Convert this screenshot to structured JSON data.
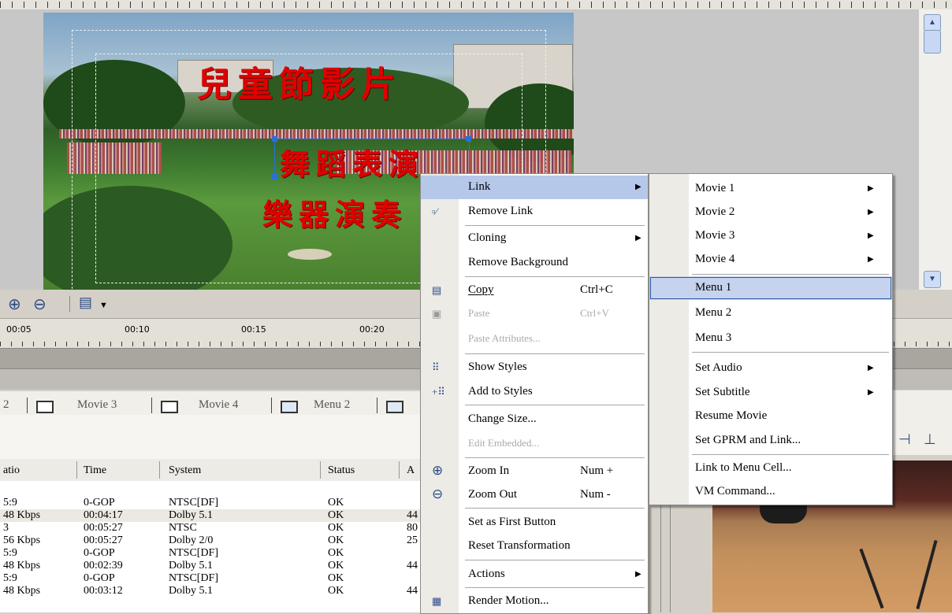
{
  "preview": {
    "title_line1": "兒童節影片",
    "title_line2": "舞蹈表演",
    "title_line3": "樂器演奏"
  },
  "timeline": {
    "labels": [
      "00:05",
      "00:10",
      "00:15",
      "00:20"
    ]
  },
  "tabs": [
    {
      "label": "2"
    },
    {
      "label": "Movie 3"
    },
    {
      "label": "Movie 4"
    },
    {
      "label": "Menu 2"
    }
  ],
  "table": {
    "headers": [
      "atio",
      "Time",
      "System",
      "Status",
      "A"
    ],
    "rows": [
      {
        "ratio": "5:9",
        "time": "0-GOP",
        "system": "NTSC[DF]",
        "status": "OK",
        "a": ""
      },
      {
        "ratio": "48 Kbps",
        "time": "00:04:17",
        "system": "Dolby 5.1",
        "status": "OK",
        "a": "44"
      },
      {
        "ratio": "3",
        "time": "00:05:27",
        "system": "NTSC",
        "status": "OK",
        "a": "80"
      },
      {
        "ratio": "56 Kbps",
        "time": "00:05:27",
        "system": "Dolby 2/0",
        "status": "OK",
        "a": "25"
      },
      {
        "ratio": "5:9",
        "time": "0-GOP",
        "system": "NTSC[DF]",
        "status": "OK",
        "a": ""
      },
      {
        "ratio": "48 Kbps",
        "time": "00:02:39",
        "system": "Dolby 5.1",
        "status": "OK",
        "a": "44"
      },
      {
        "ratio": "5:9",
        "time": "0-GOP",
        "system": "NTSC[DF]",
        "status": "OK",
        "a": ""
      },
      {
        "ratio": "48 Kbps",
        "time": "00:03:12",
        "system": "Dolby 5.1",
        "status": "OK",
        "a": "44"
      }
    ]
  },
  "context_menu": {
    "items": [
      {
        "label": "Link",
        "shortcut": "",
        "submenu": true
      },
      {
        "label": "Remove Link",
        "shortcut": "",
        "icon": "unlink-icon"
      },
      {
        "label": "Cloning",
        "shortcut": "",
        "submenu": true
      },
      {
        "label": "Remove Background",
        "shortcut": ""
      },
      {
        "label": "Copy",
        "shortcut": "Ctrl+C",
        "icon": "copy-icon"
      },
      {
        "label": "Paste",
        "shortcut": "Ctrl+V",
        "disabled": true,
        "icon": "paste-icon"
      },
      {
        "label": "Paste Attributes...",
        "shortcut": "",
        "disabled": true
      },
      {
        "label": "Show Styles",
        "shortcut": "",
        "icon": "styles-icon"
      },
      {
        "label": "Add to Styles",
        "shortcut": "",
        "icon": "add-styles-icon"
      },
      {
        "label": "Change Size...",
        "shortcut": ""
      },
      {
        "label": "Edit Embedded...",
        "shortcut": "",
        "disabled": true
      },
      {
        "label": "Zoom In",
        "shortcut": "Num +",
        "icon": "zoom-in-icon"
      },
      {
        "label": "Zoom Out",
        "shortcut": "Num -",
        "icon": "zoom-out-icon"
      },
      {
        "label": "Set as First Button",
        "shortcut": ""
      },
      {
        "label": "Reset Transformation",
        "shortcut": ""
      },
      {
        "label": "Actions",
        "shortcut": "",
        "submenu": true
      },
      {
        "label": "Render Motion...",
        "shortcut": "",
        "icon": "render-icon"
      }
    ]
  },
  "link_submenu": {
    "items": [
      {
        "label": "Movie 1",
        "submenu": true
      },
      {
        "label": "Movie 2",
        "submenu": true
      },
      {
        "label": "Movie 3",
        "submenu": true
      },
      {
        "label": "Movie 4",
        "submenu": true
      },
      {
        "label": "Menu 1",
        "selected": true
      },
      {
        "label": "Menu 2"
      },
      {
        "label": "Menu 3"
      },
      {
        "label": "Set Audio",
        "submenu": true
      },
      {
        "label": "Set Subtitle",
        "submenu": true
      },
      {
        "label": "Resume Movie"
      },
      {
        "label": "Set GPRM and Link..."
      },
      {
        "label": "Link to Menu Cell..."
      },
      {
        "label": "VM Command..."
      }
    ]
  },
  "colors": {
    "menu_highlight": "#b6c8e9",
    "submenu_selected": "#c6d3ee",
    "title_text": "#e00000"
  }
}
